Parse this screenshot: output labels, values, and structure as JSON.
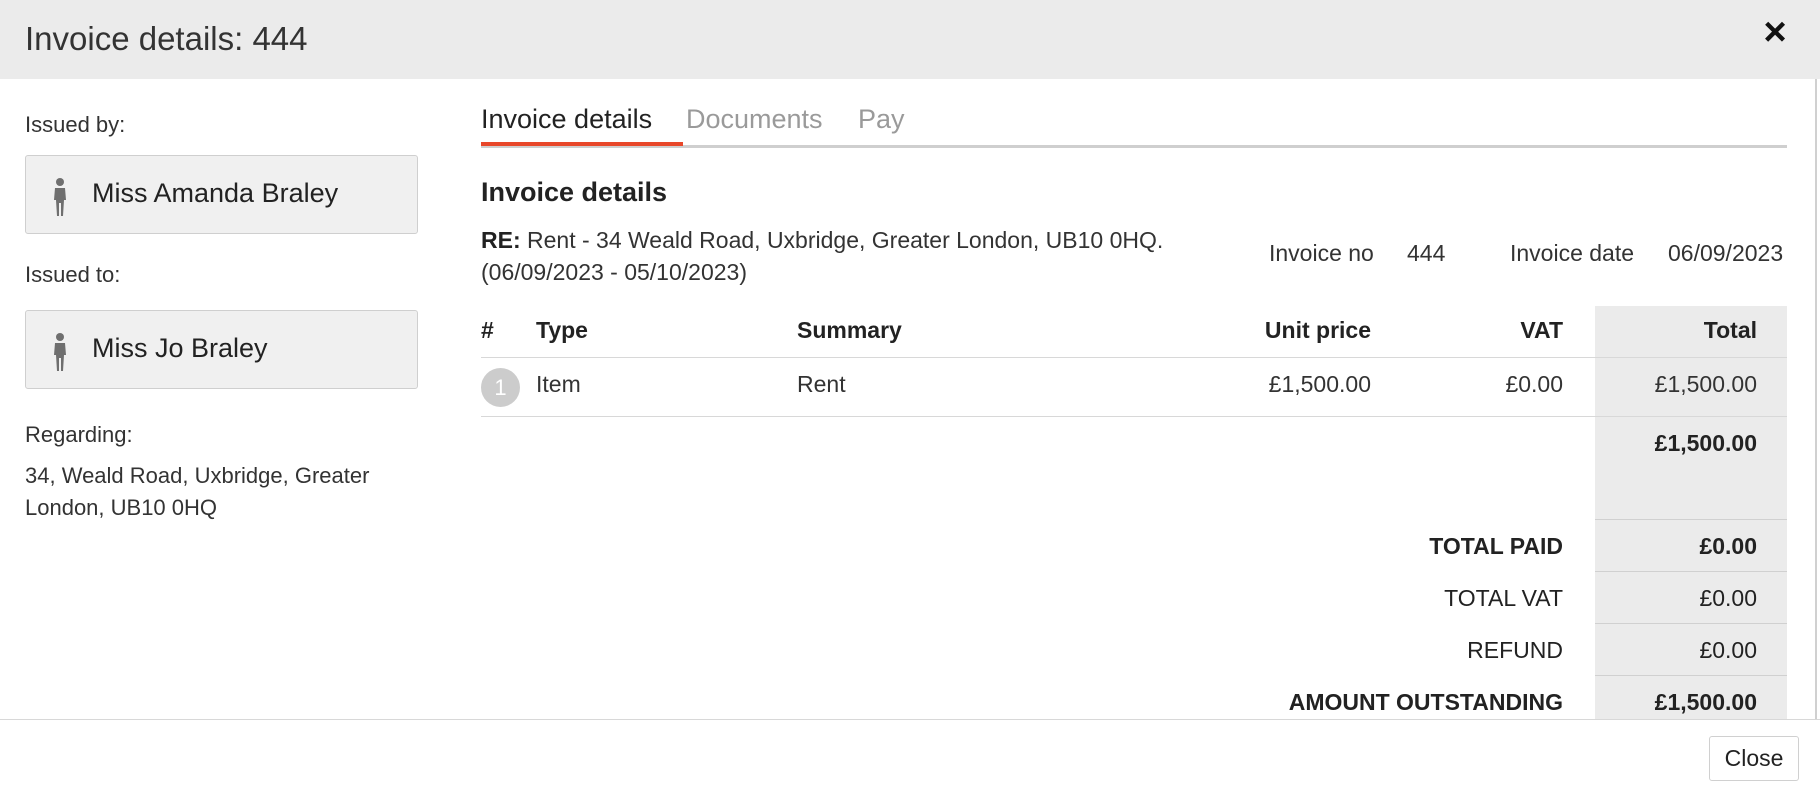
{
  "modal": {
    "title": "Invoice details: 444",
    "close_icon": "×"
  },
  "sidebar": {
    "issued_by_label": "Issued by:",
    "issued_by_name": "Miss Amanda Braley",
    "issued_to_label": "Issued to:",
    "issued_to_name": "Miss Jo Braley",
    "regarding_label": "Regarding:",
    "regarding_text": "34, Weald Road, Uxbridge, Greater London, UB10 0HQ",
    "person_icon": "person-icon"
  },
  "tabs": [
    {
      "label": "Invoice details",
      "active": true
    },
    {
      "label": "Documents",
      "active": false
    },
    {
      "label": "Pay",
      "active": false
    }
  ],
  "details": {
    "section_title": "Invoice details",
    "re_label": "RE:",
    "re_text": "Rent - 34 Weald Road, Uxbridge, Greater London, UB10 0HQ. (06/09/2023 - 05/10/2023)",
    "invoice_no_label": "Invoice no",
    "invoice_no": "444",
    "invoice_date_label": "Invoice date",
    "invoice_date": "06/09/2023"
  },
  "table": {
    "headers": [
      "#",
      "Type",
      "Summary",
      "Unit price",
      "VAT",
      "Total"
    ],
    "rows": [
      {
        "num": "1",
        "type": "Item",
        "summary": "Rent",
        "unit_price": "£1,500.00",
        "vat": "£0.00",
        "total": "£1,500.00"
      }
    ],
    "subtotal": "£1,500.00"
  },
  "summary": {
    "total_paid_label": "TOTAL PAID",
    "total_paid": "£0.00",
    "total_vat_label": "TOTAL VAT",
    "total_vat": "£0.00",
    "refund_label": "REFUND",
    "refund": "£0.00",
    "outstanding_label": "AMOUNT OUTSTANDING",
    "outstanding": "£1,500.00"
  },
  "footer": {
    "close_label": "Close"
  },
  "colors": {
    "accent": "#e8472a",
    "header_bg": "#ebebeb",
    "total_col_bg": "#ebebeb"
  }
}
